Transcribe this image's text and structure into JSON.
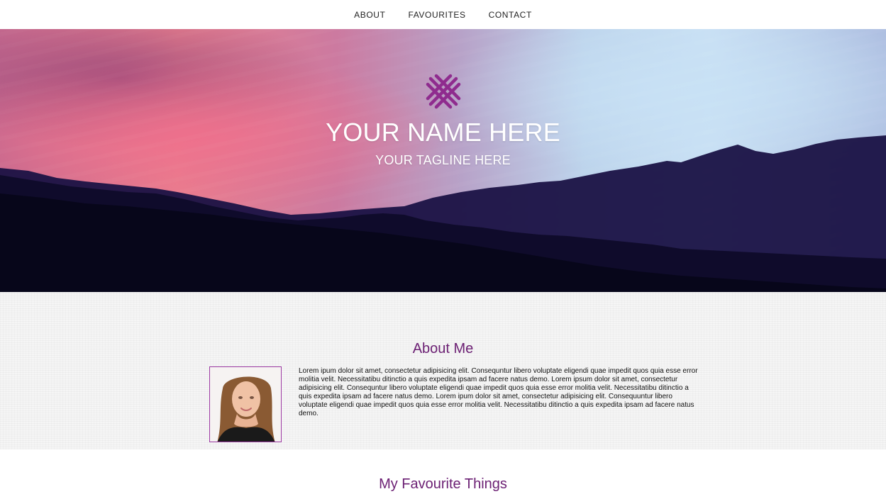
{
  "nav": {
    "items": [
      {
        "label": "ABOUT"
      },
      {
        "label": "FAVOURITES"
      },
      {
        "label": "CONTACT"
      }
    ]
  },
  "hero": {
    "logo_icon": "cross-hatch-x-icon",
    "name": "YOUR NAME HERE",
    "tagline": "YOUR TAGLINE HERE"
  },
  "about": {
    "title": "About Me",
    "photo_icon": "portrait-photo",
    "text": "Lorem ipum dolor sit amet, consectetur adipisicing elit. Consequntur libero voluptate eligendi quae impedit quos quia esse error molitia velit. Necessitatibu ditinctio a quis expedita ipsam ad facere natus demo. Lorem ipsum dolor sit amet, consectetur adipisicing elit. Consequntur libero voluptate eligendi quae impedit quos quia esse error molitia velit. Necessitatibu ditinctio a quis expedita ipsam ad facere natus demo. Lorem ipum dolor sit amet, consectetur adipisicing elit. Consequuntur libero voluptate eligendi quae impedit quos quia esse error molitia velit. Necessitatibu ditinctio a quis expedita ipsam ad facere natus demo."
  },
  "favourites": {
    "title": "My Favourite Things"
  },
  "colors": {
    "accent_purple": "#6b1f73",
    "logo_purple": "#8f2b8e",
    "photo_border": "#9c3aa3"
  }
}
